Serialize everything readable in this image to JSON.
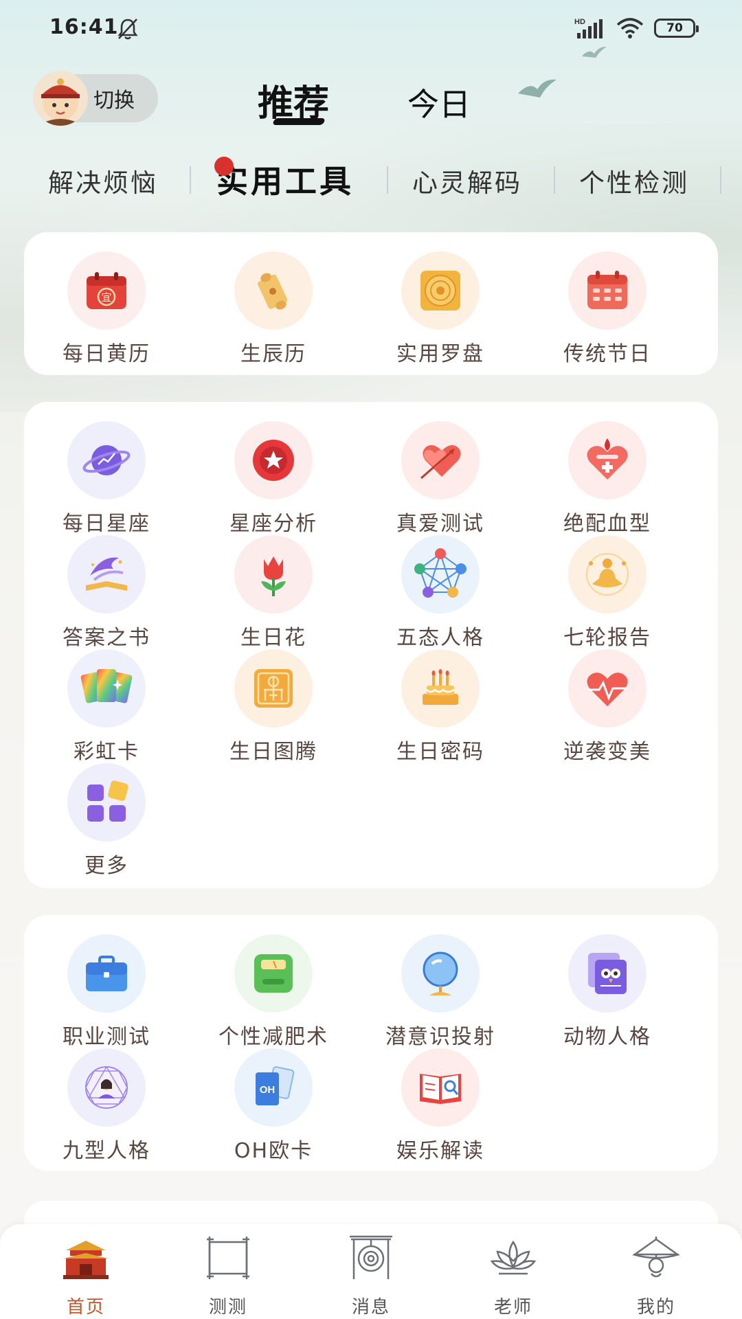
{
  "status_bar": {
    "time": "16:41",
    "network": "HD",
    "battery": "70"
  },
  "header": {
    "switch_label": "切换",
    "tabs": [
      {
        "label": "推荐",
        "active": true
      },
      {
        "label": "今日",
        "active": false
      }
    ]
  },
  "sub_tabs": [
    {
      "label": "解决烦恼",
      "active": false
    },
    {
      "label": "实用工具",
      "active": true
    },
    {
      "label": "心灵解码",
      "active": false
    },
    {
      "label": "个性检测",
      "active": false
    }
  ],
  "cards": {
    "basic": [
      {
        "label": "每日黄历",
        "icon": "almanac-icon"
      },
      {
        "label": "生辰历",
        "icon": "scroll-icon"
      },
      {
        "label": "实用罗盘",
        "icon": "compass-icon"
      },
      {
        "label": "传统节日",
        "icon": "calendar-icon"
      }
    ],
    "astro": [
      {
        "label": "每日星座",
        "icon": "planet-icon"
      },
      {
        "label": "星座分析",
        "icon": "star-badge-icon"
      },
      {
        "label": "真爱测试",
        "icon": "heart-arrow-icon"
      },
      {
        "label": "绝配血型",
        "icon": "blood-heart-icon"
      },
      {
        "label": "答案之书",
        "icon": "magic-book-icon"
      },
      {
        "label": "生日花",
        "icon": "tulip-icon"
      },
      {
        "label": "五态人格",
        "icon": "network-icon"
      },
      {
        "label": "七轮报告",
        "icon": "meditation-icon"
      },
      {
        "label": "彩虹卡",
        "icon": "rainbow-cards-icon"
      },
      {
        "label": "生日图腾",
        "icon": "totem-icon"
      },
      {
        "label": "生日密码",
        "icon": "birthday-cake-icon"
      },
      {
        "label": "逆袭变美",
        "icon": "heartbeat-icon"
      },
      {
        "label": "更多",
        "icon": "more-grid-icon"
      }
    ],
    "personality": [
      {
        "label": "职业测试",
        "icon": "briefcase-icon"
      },
      {
        "label": "个性减肥术",
        "icon": "scale-icon"
      },
      {
        "label": "潜意识投射",
        "icon": "mirror-icon"
      },
      {
        "label": "动物人格",
        "icon": "owl-icon"
      },
      {
        "label": "九型人格",
        "icon": "enneagram-icon"
      },
      {
        "label": "OH欧卡",
        "icon": "oh-cards-icon"
      },
      {
        "label": "娱乐解读",
        "icon": "book-search-icon"
      }
    ]
  },
  "bottom_nav": [
    {
      "label": "首页",
      "icon": "palace-icon",
      "active": true
    },
    {
      "label": "测测",
      "icon": "scroll-frame-icon",
      "active": false
    },
    {
      "label": "消息",
      "icon": "gong-icon",
      "active": false
    },
    {
      "label": "老师",
      "icon": "lotus-icon",
      "active": false
    },
    {
      "label": "我的",
      "icon": "pavilion-icon",
      "active": false
    }
  ],
  "colors": {
    "accent": "#c0572c",
    "label": "#5a4640",
    "red_dot": "#d9322e"
  }
}
